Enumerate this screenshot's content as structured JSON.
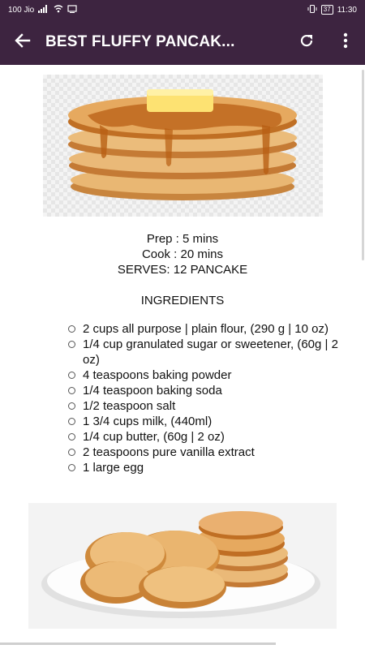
{
  "status_bar": {
    "carrier": "100 Jio",
    "battery": "37",
    "time": "11:30"
  },
  "app_bar": {
    "title": "BEST FLUFFY PANCAK...",
    "icons": [
      "arrow-back-icon",
      "refresh-icon",
      "more-vert-icon"
    ]
  },
  "recipe": {
    "prep": "Prep : 5 mins",
    "cook": "Cook : 20 mins",
    "serves": "SERVES: 12 PANCAKE",
    "ingredients_heading": "INGREDIENTS",
    "ingredients": [
      "2 cups all purpose | plain flour, (290 g | 10 oz)",
      "1/4 cup granulated sugar or sweetener, (60g | 2 oz)",
      "4 teaspoons baking powder",
      "1/4 teaspoon baking soda",
      "1/2 teaspoon salt",
      "1 3/4 cups milk, (440ml)",
      "1/4 cup butter, (60g | 2 oz)",
      "2 teaspoons pure vanilla extract",
      "1 large egg"
    ]
  },
  "colors": {
    "app_bar": "#3d2440"
  }
}
